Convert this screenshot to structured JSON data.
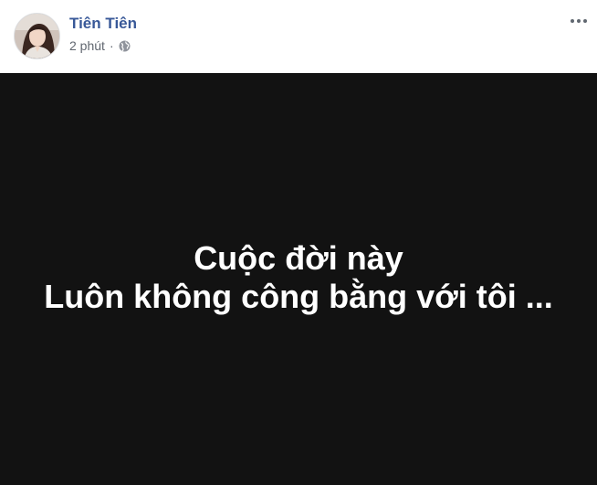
{
  "post": {
    "author_name": "Tiên Tiên",
    "timestamp": "2 phút",
    "meta_separator": "·",
    "privacy_icon": "globe-icon",
    "more_icon": "more-options-icon",
    "status_lines": [
      "Cuộc đời này",
      "Luôn không công bằng với tôi ..."
    ]
  },
  "colors": {
    "author_name": "#385898",
    "meta_text": "#616770",
    "status_background": "#121212",
    "status_text": "#ffffff"
  }
}
